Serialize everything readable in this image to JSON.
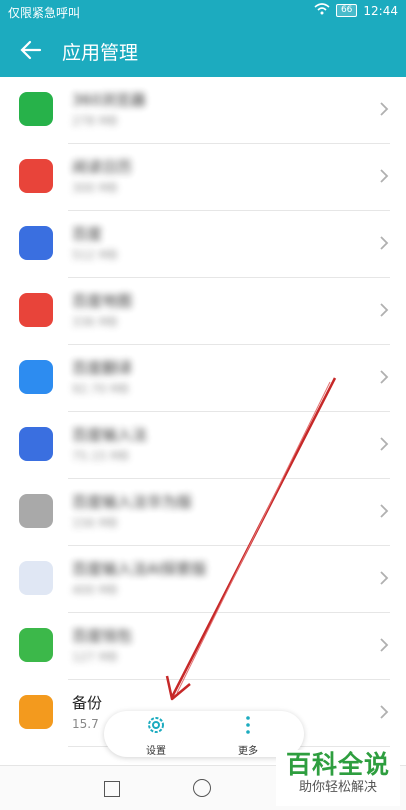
{
  "status": {
    "left_text": "仅限紧急呼叫",
    "battery": "66",
    "time": "12:44"
  },
  "header": {
    "title": "应用管理"
  },
  "apps": [
    {
      "name": "360浏览器",
      "size": "278 MB",
      "blurred": true,
      "color": "#27b24a",
      "icon": "360-browser-icon"
    },
    {
      "name": "阅读日历",
      "size": "300 MB",
      "blurred": true,
      "color": "#e8443a",
      "icon": "calendar-app-icon"
    },
    {
      "name": "百度",
      "size": "512 MB",
      "blurred": true,
      "color": "#3a6fe0",
      "icon": "baidu-paw-icon"
    },
    {
      "name": "百度地图",
      "size": "336 MB",
      "blurred": true,
      "color": "#e8443a",
      "icon": "map-pin-icon"
    },
    {
      "name": "百度翻译",
      "size": "92.70 MB",
      "blurred": true,
      "color": "#2d8cf0",
      "icon": "translate-icon"
    },
    {
      "name": "百度输入法",
      "size": "75.15 MB",
      "blurred": true,
      "color": "#3a6fe0",
      "icon": "keyboard-app-icon"
    },
    {
      "name": "百度输入法华为版",
      "size": "156 MB",
      "blurred": true,
      "color": "#a9a9a9",
      "icon": "letter-a-icon"
    },
    {
      "name": "百度输入法AI探索版",
      "size": "400 MB",
      "blurred": true,
      "color": "#e0e7f4",
      "icon": "paw-keyboard-icon"
    },
    {
      "name": "百度钱包",
      "size": "127 MB",
      "blurred": true,
      "color": "#3cb84a",
      "icon": "wallet-icon"
    },
    {
      "name": "备份",
      "size": "15.7",
      "blurred": false,
      "color": "#f39a1e",
      "icon": "backup-icon"
    }
  ],
  "popup": {
    "settings_label": "设置",
    "more_label": "更多"
  },
  "watermark": {
    "line1": "百科全说",
    "line2": "助你轻松解决"
  },
  "colors": {
    "accent": "#1cabbf",
    "annotation_arrow": "#c62828"
  }
}
